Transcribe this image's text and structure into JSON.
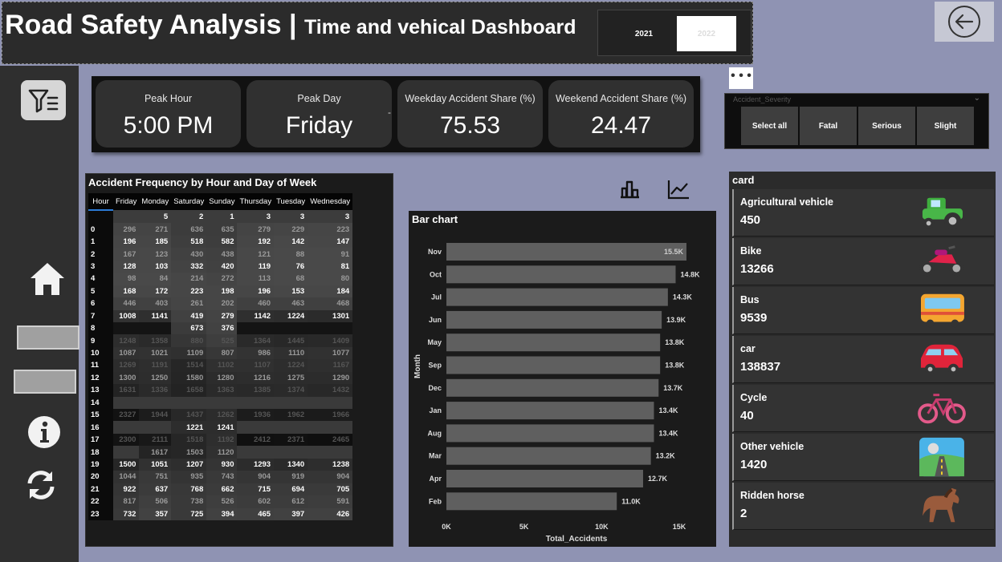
{
  "header": {
    "title": "Road Safety Analysis |",
    "subtitle": "Time and vehical Dashboard",
    "years": [
      "2021",
      "2022"
    ]
  },
  "kpis": [
    {
      "label": "Peak Hour",
      "value": "5:00 PM"
    },
    {
      "label": "Peak Day",
      "value": "Friday"
    },
    {
      "label": "Weekday Accident Share (%)",
      "value": "75.53"
    },
    {
      "label": "Weekend Accident Share (%)",
      "value": "24.47"
    }
  ],
  "kpi_separator": "-",
  "more_button": "• • •",
  "severity": {
    "title": "Accident_Severity",
    "chevron": "⌄",
    "options": [
      "Select all",
      "Fatal",
      "Serious",
      "Slight"
    ]
  },
  "heatmap": {
    "title": "Accident Frequency by Hour and Day of Week",
    "columns": [
      "Hour",
      "Friday",
      "Monday",
      "Saturday",
      "Sunday",
      "Thursday",
      "Tuesday",
      "Wednesday"
    ],
    "rows": [
      [
        "",
        "",
        "5",
        "2",
        "1",
        "3",
        "3",
        "3"
      ],
      [
        "0",
        "296",
        "271",
        "636",
        "635",
        "279",
        "229",
        "223"
      ],
      [
        "1",
        "196",
        "185",
        "518",
        "582",
        "192",
        "142",
        "147"
      ],
      [
        "2",
        "167",
        "123",
        "430",
        "438",
        "121",
        "88",
        "91"
      ],
      [
        "3",
        "128",
        "103",
        "332",
        "420",
        "119",
        "76",
        "81"
      ],
      [
        "4",
        "98",
        "84",
        "214",
        "272",
        "113",
        "68",
        "80"
      ],
      [
        "5",
        "168",
        "172",
        "223",
        "198",
        "196",
        "153",
        "184"
      ],
      [
        "6",
        "446",
        "403",
        "261",
        "202",
        "460",
        "463",
        "468"
      ],
      [
        "7",
        "1008",
        "1141",
        "419",
        "279",
        "1142",
        "1224",
        "1301"
      ],
      [
        "8",
        "",
        "",
        "673",
        "376",
        "",
        "",
        ""
      ],
      [
        "9",
        "1248",
        "1358",
        "880",
        "525",
        "1364",
        "1445",
        "1409"
      ],
      [
        "10",
        "1087",
        "1021",
        "1109",
        "807",
        "986",
        "1110",
        "1077"
      ],
      [
        "11",
        "1269",
        "1191",
        "1514",
        "1102",
        "1107",
        "1224",
        "1167"
      ],
      [
        "12",
        "1300",
        "1250",
        "1580",
        "1280",
        "1216",
        "1275",
        "1290"
      ],
      [
        "13",
        "1631",
        "1336",
        "1658",
        "1363",
        "1385",
        "1374",
        "1432"
      ],
      [
        "14",
        "",
        "",
        "",
        "",
        "",
        "",
        ""
      ],
      [
        "15",
        "2327",
        "1944",
        "1437",
        "1262",
        "1936",
        "1962",
        "1966"
      ],
      [
        "16",
        "",
        "",
        "1221",
        "1241",
        "",
        "",
        ""
      ],
      [
        "17",
        "2300",
        "2111",
        "1518",
        "1192",
        "2412",
        "2371",
        "2465"
      ],
      [
        "18",
        "",
        "1617",
        "1503",
        "1120",
        "",
        "",
        ""
      ],
      [
        "19",
        "1500",
        "1051",
        "1207",
        "930",
        "1293",
        "1340",
        "1238"
      ],
      [
        "20",
        "1044",
        "751",
        "935",
        "743",
        "904",
        "919",
        "904"
      ],
      [
        "21",
        "922",
        "637",
        "768",
        "662",
        "715",
        "694",
        "705"
      ],
      [
        "22",
        "817",
        "506",
        "738",
        "526",
        "602",
        "612",
        "591"
      ],
      [
        "23",
        "732",
        "357",
        "725",
        "394",
        "465",
        "397",
        "426"
      ]
    ]
  },
  "bar_panel": {
    "title": "Bar chart"
  },
  "chart_data": {
    "type": "bar",
    "orientation": "horizontal",
    "categories": [
      "Nov",
      "Oct",
      "Jul",
      "Jun",
      "May",
      "Sep",
      "Dec",
      "Jan",
      "Aug",
      "Mar",
      "Apr",
      "Feb"
    ],
    "values": [
      15500,
      14800,
      14300,
      13900,
      13800,
      13800,
      13700,
      13400,
      13400,
      13200,
      12700,
      11000
    ],
    "data_labels": [
      "15.5K",
      "14.8K",
      "14.3K",
      "13.9K",
      "13.8K",
      "13.8K",
      "13.7K",
      "13.4K",
      "13.4K",
      "13.2K",
      "12.7K",
      "11.0K"
    ],
    "xlabel": "Total_Accidents",
    "ylabel": "Month",
    "xticks": [
      "0K",
      "5K",
      "10K",
      "15K"
    ],
    "xlim": [
      0,
      15500
    ],
    "bar_color": "#5f5f5f"
  },
  "cards": {
    "title": "card",
    "items": [
      {
        "label": "Agricultural vehicle",
        "value": "450",
        "icon": "tractor-icon"
      },
      {
        "label": "Bike",
        "value": "13266",
        "icon": "motorbike-icon"
      },
      {
        "label": "Bus",
        "value": "9539",
        "icon": "bus-icon"
      },
      {
        "label": "car",
        "value": "138837",
        "icon": "car-icon"
      },
      {
        "label": "Cycle",
        "value": "40",
        "icon": "bicycle-icon"
      },
      {
        "label": "Other vehicle",
        "value": "1420",
        "icon": "road-icon"
      },
      {
        "label": "Ridden horse",
        "value": "2",
        "icon": "horse-icon"
      }
    ]
  },
  "colors": {
    "page_bg": "#8f93b3",
    "panel_bg": "#1b1b1b",
    "nav_bg": "#2f2f2f",
    "accent_blue": "#2b7bd6"
  }
}
